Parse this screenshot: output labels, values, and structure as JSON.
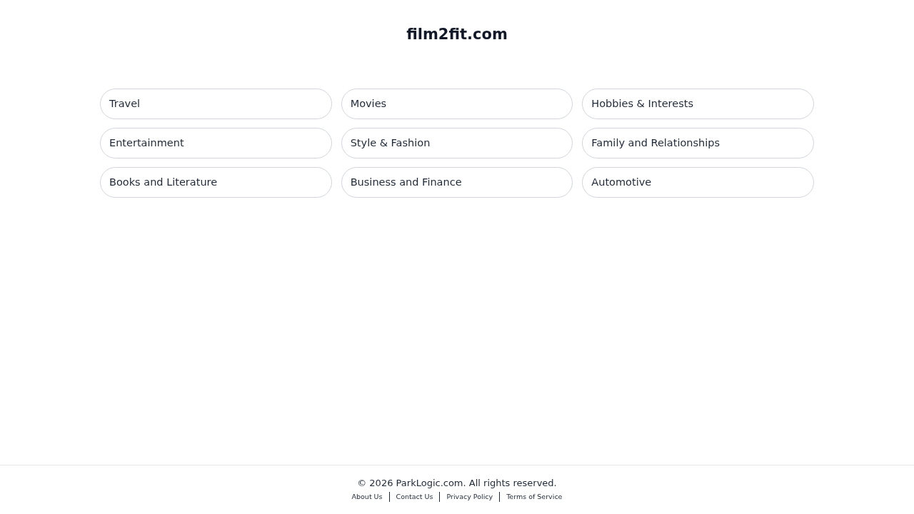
{
  "header": {
    "title": "film2fit.com"
  },
  "categories": [
    "Travel",
    "Movies",
    "Hobbies & Interests",
    "Entertainment",
    "Style & Fashion",
    "Family and Relationships",
    "Books and Literature",
    "Business and Finance",
    "Automotive"
  ],
  "footer": {
    "copyright": "© 2026 ParkLogic.com. All rights reserved.",
    "links": [
      "About Us",
      "Contact Us",
      "Privacy Policy",
      "Terms of Service"
    ]
  }
}
